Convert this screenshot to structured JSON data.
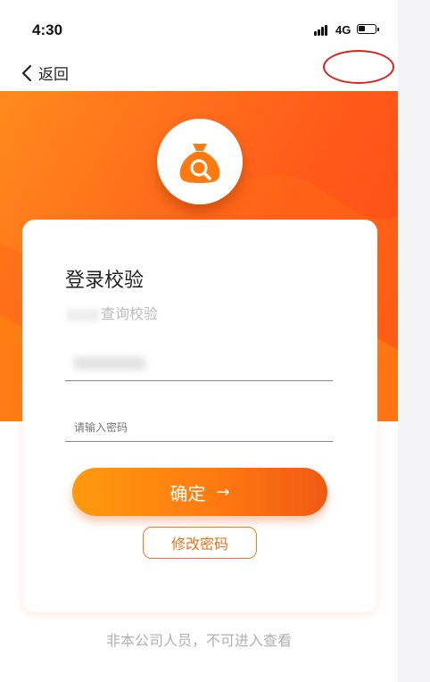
{
  "status_bar": {
    "time": "4:30",
    "network": "4G"
  },
  "nav": {
    "back_label": "返回"
  },
  "login_card": {
    "title": "登录校验",
    "subtitle": "查询校验",
    "password_placeholder": "请输入密码",
    "confirm_label": "确定",
    "confirm_arrow": "→",
    "modify_password_label": "修改密码"
  },
  "footer": {
    "notice": "非本公司人员，不可进入查看"
  },
  "colors": {
    "accent": "#ff7a10",
    "annotation": "#d9201d"
  },
  "icons": [
    "chevron-left-icon",
    "money-bag-search-icon",
    "signal-icon",
    "battery-icon",
    "arrow-right-icon"
  ]
}
